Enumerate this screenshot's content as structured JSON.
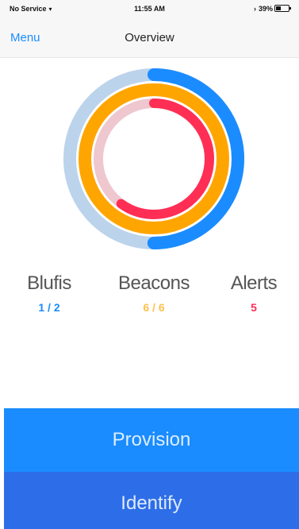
{
  "status_bar": {
    "carrier": "No Service",
    "time": "11:55 AM",
    "battery_percent": "39%",
    "battery_level": 0.39,
    "wifi_icon": "wifi-icon",
    "bluetooth_icon": "bluetooth-icon"
  },
  "nav": {
    "menu_label": "Menu",
    "title": "Overview"
  },
  "rings": {
    "blufis": {
      "fraction": 0.5,
      "color": "#1a8cff",
      "track_color": "#bcd3ec"
    },
    "beacons": {
      "fraction": 1.0,
      "color": "#ffa500",
      "track_color": "#ffd99b"
    },
    "alerts": {
      "fraction": 0.6,
      "color": "#ff2e55",
      "track_color": "#eec7cf"
    }
  },
  "stats": {
    "blufis": {
      "label": "Blufis",
      "value": "1 / 2",
      "color": "#1a8cff"
    },
    "beacons": {
      "label": "Beacons",
      "value": "6 / 6",
      "color": "#ffc04d"
    },
    "alerts": {
      "label": "Alerts",
      "value": "5",
      "color": "#ff2e55"
    }
  },
  "buttons": {
    "provision": {
      "label": "Provision",
      "color": "#1a8cff"
    },
    "identify": {
      "label": "Identify",
      "color": "#2d6ee8"
    }
  }
}
